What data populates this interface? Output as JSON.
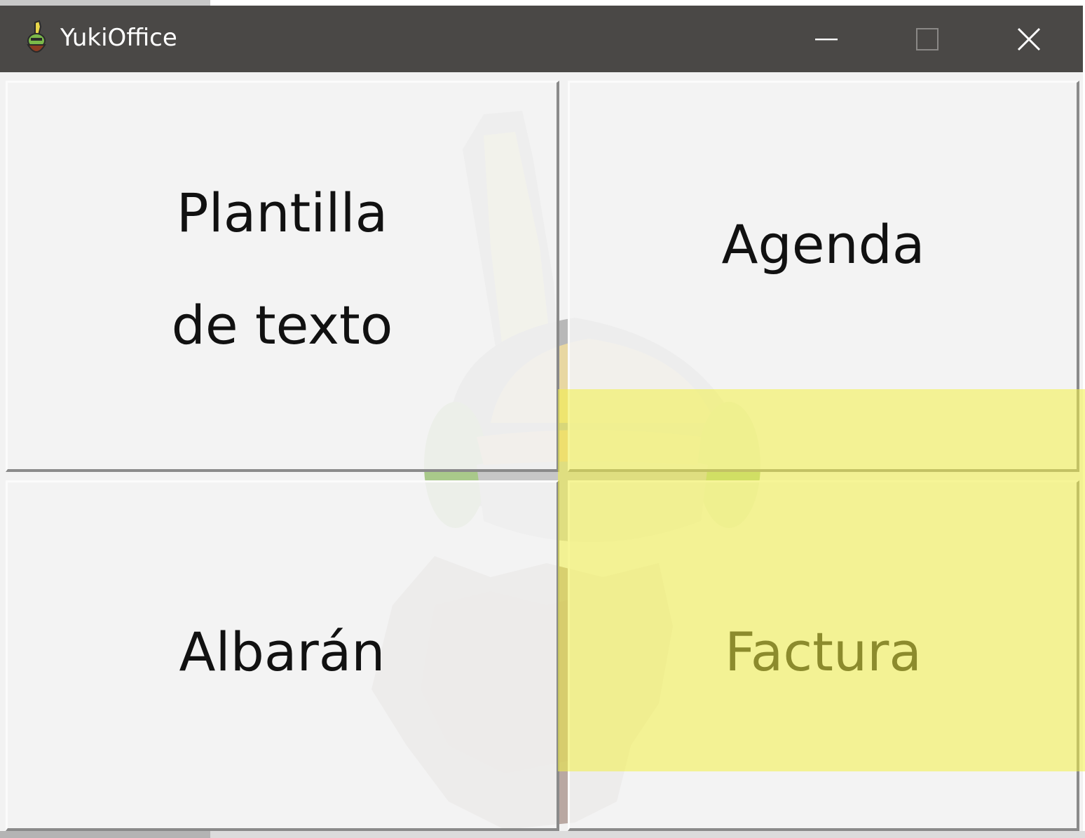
{
  "window": {
    "title": "YukiOffice",
    "controls": {
      "minimize": "minimize",
      "maximize": "maximize",
      "close": "close"
    }
  },
  "menu": {
    "tiles": [
      {
        "lines": [
          "Plantilla",
          "de texto"
        ]
      },
      {
        "label": "Agenda"
      },
      {
        "label": "Albarán"
      },
      {
        "label": "Factura"
      }
    ],
    "hovered_tile": "Factura"
  },
  "colors": {
    "titlebar": "#4a4846",
    "client_bg": "#f2f2f2",
    "hover_highlight": "#f3f046",
    "text": "#111111"
  },
  "icons": {
    "app": "banana-viking-mascot-icon",
    "background": "banana-viking-mascot-watermark"
  }
}
